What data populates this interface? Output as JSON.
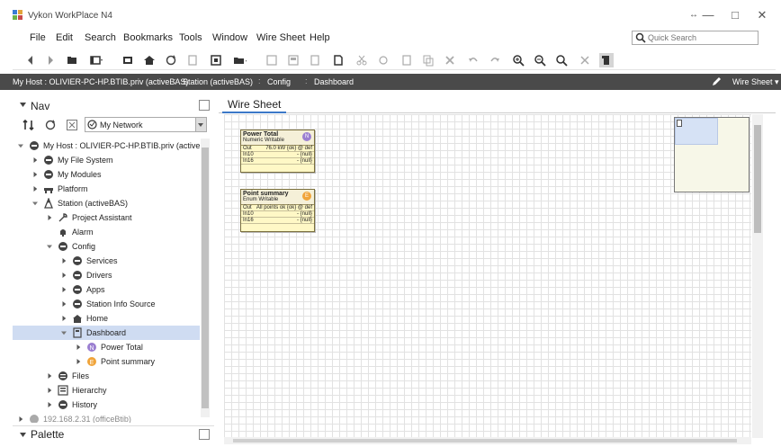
{
  "window": {
    "title": "Vykon WorkPlace N4",
    "controls": {
      "pin": "↔",
      "minimize": "—",
      "maximize": "□",
      "close": "✕"
    }
  },
  "menu": {
    "items": [
      "File",
      "Edit",
      "Search",
      "Bookmarks",
      "Tools",
      "Window",
      "Wire Sheet",
      "Help"
    ]
  },
  "quicksearch": {
    "placeholder": "Quick Search"
  },
  "breadcrumb": {
    "items": [
      "My Host : OLIVIER-PC-HP.BTIB.priv (activeBAS)",
      "Station (activeBAS)",
      "Config",
      "Dashboard"
    ],
    "separator": ":",
    "view_selector": "Wire Sheet"
  },
  "nav": {
    "title": "Nav",
    "network_select": "My Network",
    "tree": [
      {
        "label": "My Host : OLIVIER-PC-HP.BTIB.priv (activeBAS)",
        "depth": 0,
        "expanded": true,
        "icon": "host-icon"
      },
      {
        "label": "My File System",
        "depth": 1,
        "expanded": false,
        "icon": "file-system-icon"
      },
      {
        "label": "My Modules",
        "depth": 1,
        "expanded": false,
        "icon": "modules-icon"
      },
      {
        "label": "Platform",
        "depth": 1,
        "expanded": false,
        "icon": "platform-icon"
      },
      {
        "label": "Station (activeBAS)",
        "depth": 1,
        "expanded": true,
        "icon": "station-icon"
      },
      {
        "label": "Project Assistant",
        "depth": 2,
        "expanded": false,
        "icon": "wrench-icon"
      },
      {
        "label": "Alarm",
        "depth": 2,
        "expanded": null,
        "icon": "bell-icon"
      },
      {
        "label": "Config",
        "depth": 2,
        "expanded": true,
        "icon": "config-icon"
      },
      {
        "label": "Services",
        "depth": 3,
        "expanded": false,
        "icon": "services-icon"
      },
      {
        "label": "Drivers",
        "depth": 3,
        "expanded": false,
        "icon": "drivers-icon"
      },
      {
        "label": "Apps",
        "depth": 3,
        "expanded": false,
        "icon": "apps-icon"
      },
      {
        "label": "Station Info Source",
        "depth": 3,
        "expanded": false,
        "icon": "info-source-icon"
      },
      {
        "label": "Home",
        "depth": 3,
        "expanded": false,
        "icon": "home-icon"
      },
      {
        "label": "Dashboard",
        "depth": 3,
        "expanded": true,
        "icon": "dashboard-icon",
        "selected": true
      },
      {
        "label": "Power Total",
        "depth": 4,
        "expanded": false,
        "icon": "numeric-writable-icon"
      },
      {
        "label": "Point summary",
        "depth": 4,
        "expanded": false,
        "icon": "enum-writable-icon"
      },
      {
        "label": "Files",
        "depth": 2,
        "expanded": false,
        "icon": "files-icon"
      },
      {
        "label": "Hierarchy",
        "depth": 2,
        "expanded": false,
        "icon": "hierarchy-icon"
      },
      {
        "label": "History",
        "depth": 2,
        "expanded": false,
        "icon": "history-icon"
      },
      {
        "label": "192.168.2.31 (officeBtib)",
        "depth": 0,
        "expanded": false,
        "icon": "host-icon"
      }
    ]
  },
  "palette": {
    "title": "Palette"
  },
  "wiresheet": {
    "tab_label": "Wire Sheet",
    "components": [
      {
        "title": "Power Total",
        "type": "Numeric Writable",
        "badge": "N",
        "badge_color": "#9b7fd1",
        "slots": [
          {
            "name": "Out",
            "value": "76.0 kW {ok} @ def"
          },
          {
            "name": "In10",
            "value": "- {null}"
          },
          {
            "name": "In16",
            "value": "- {null}"
          }
        ]
      },
      {
        "title": "Point summary",
        "type": "Enum Writable",
        "badge": "E",
        "badge_color": "#f0a43a",
        "slots": [
          {
            "name": "Out",
            "value": "All points ok {ok} @ def"
          },
          {
            "name": "In10",
            "value": "- {null}"
          },
          {
            "name": "In16",
            "value": "- {null}"
          }
        ]
      }
    ]
  }
}
